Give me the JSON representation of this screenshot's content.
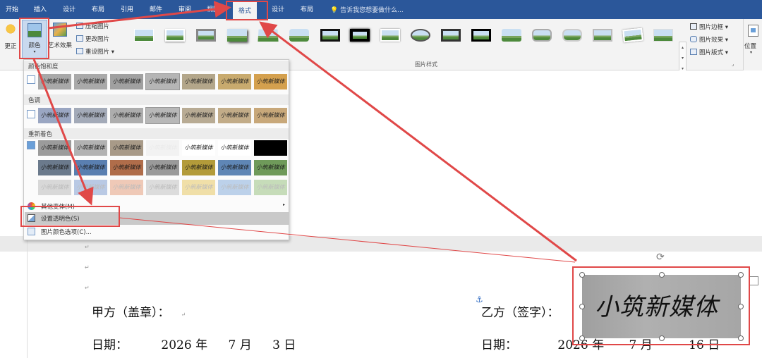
{
  "tabs": [
    "开始",
    "插入",
    "设计",
    "布局",
    "引用",
    "邮件",
    "审阅",
    "视图",
    "格式",
    "设计",
    "布局"
  ],
  "tell_me": "告诉我您想要做什么...",
  "ribbon": {
    "correct_label": "更正",
    "color_label": "颜色",
    "art_effects_label": "艺术效果",
    "compress_label": "压缩图片",
    "change_label": "更改图片",
    "reset_label": "重设图片",
    "picture_styles_group": "图片样式",
    "border_label": "图片边框",
    "effects_label": "图片效果",
    "layout_label": "图片版式",
    "position_label": "位置"
  },
  "menu": {
    "saturation_title": "颜色饱和度",
    "tone_title": "色调",
    "recolor_title": "重新着色",
    "thumb_text": "小筑新媒体",
    "more_colors": "其他变体(M)",
    "set_transparent": "设置透明色(S)",
    "color_options": "图片颜色选项(C)..."
  },
  "document": {
    "party_a": "甲方（盖章）：",
    "party_b": "乙方（签字）：",
    "date_label": "日期：",
    "date_a": {
      "year": "2026",
      "month": "7",
      "day": "3"
    },
    "date_b": {
      "year": "2026",
      "month": "7",
      "day": "16"
    },
    "year_unit": "年",
    "month_unit": "月",
    "day_unit": "日",
    "signature": "小筑新媒体"
  },
  "colors": {
    "accent": "#2b579a",
    "highlight": "#e04848"
  }
}
